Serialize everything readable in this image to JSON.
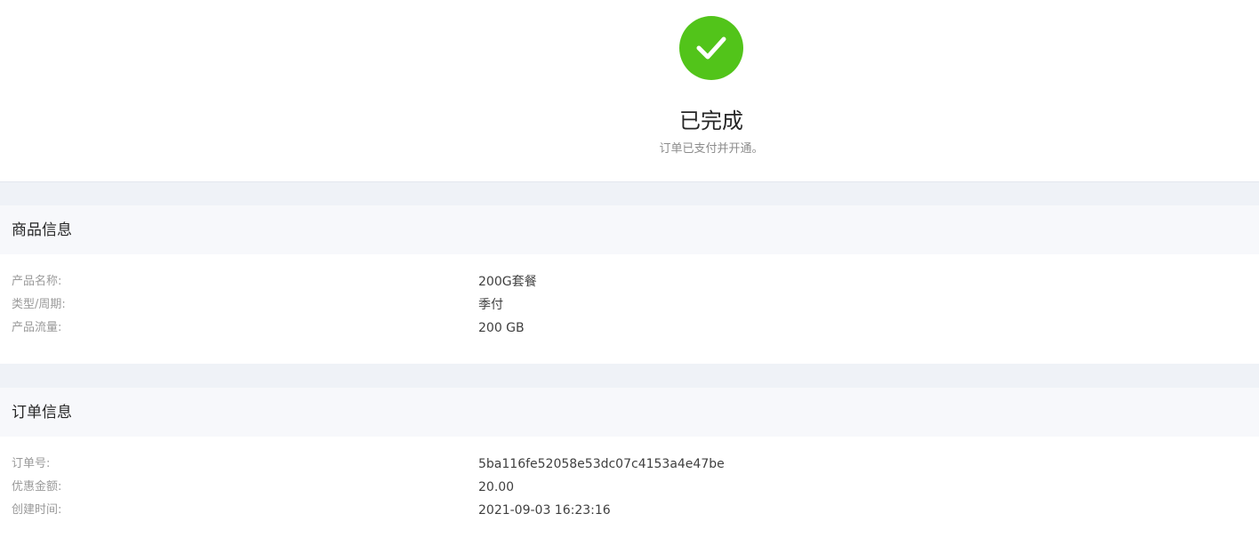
{
  "result": {
    "status_icon": "check-circle-icon",
    "status_color": "#52c41a",
    "title": "已完成",
    "subtitle": "订单已支付并开通。"
  },
  "product_section": {
    "heading": "商品信息",
    "rows": [
      {
        "label": "产品名称:",
        "value": "200G套餐"
      },
      {
        "label": "类型/周期:",
        "value": "季付"
      },
      {
        "label": "产品流量:",
        "value": "200 GB"
      }
    ]
  },
  "order_section": {
    "heading": "订单信息",
    "rows": [
      {
        "label": "订单号:",
        "value": "5ba116fe52058e53dc07c4153a4e47be"
      },
      {
        "label": "优惠金额:",
        "value": "20.00"
      },
      {
        "label": "创建时间:",
        "value": "2021-09-03 16:23:16"
      }
    ]
  }
}
